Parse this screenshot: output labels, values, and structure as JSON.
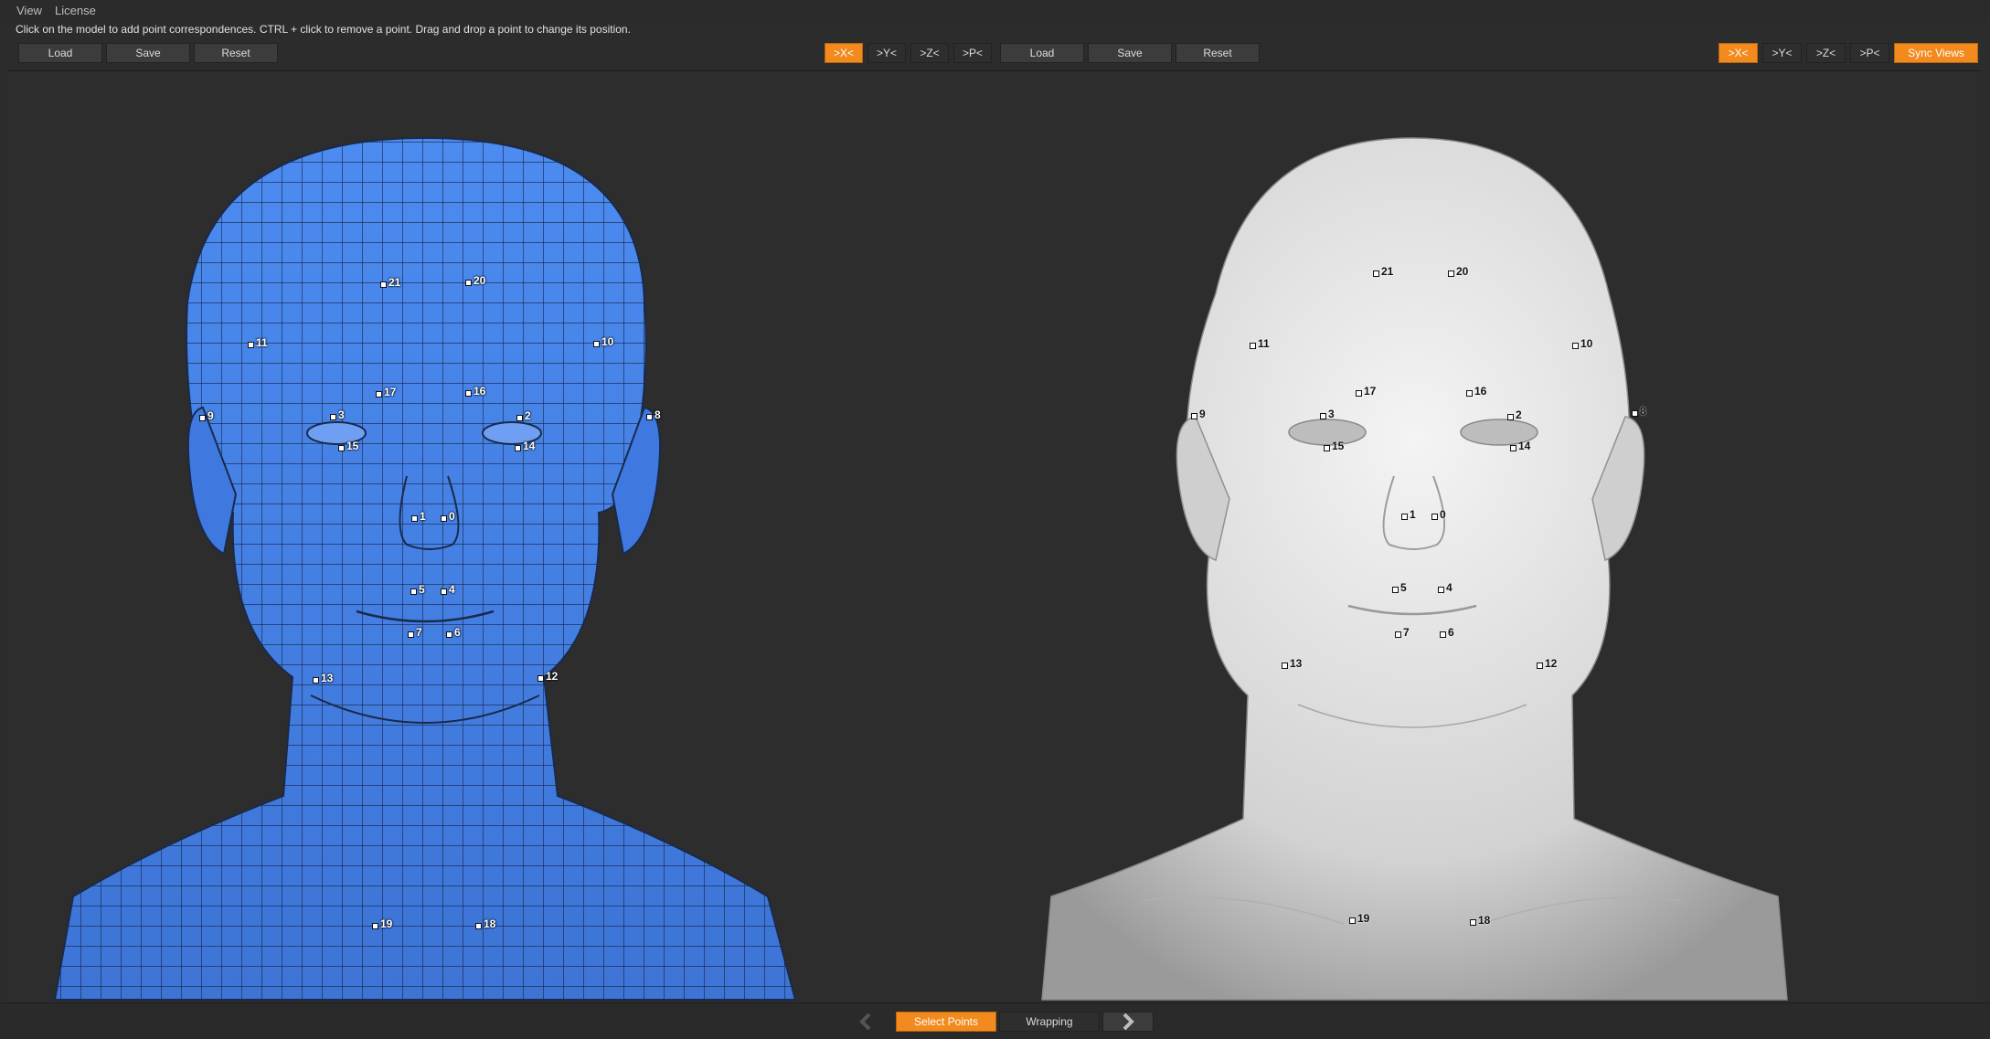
{
  "menu": {
    "view": "View",
    "license": "License"
  },
  "hint": "Click on the model to add point correspondences. CTRL + click to remove a point. Drag and drop a point to change its position.",
  "left_toolbar": {
    "load": "Load",
    "save": "Save",
    "reset": "Reset"
  },
  "right_toolbar": {
    "load": "Load",
    "save": "Save",
    "reset": "Reset"
  },
  "left_views": [
    ">X<",
    ">Y<",
    ">Z<",
    ">P<"
  ],
  "right_views": [
    ">X<",
    ">Y<",
    ">Z<",
    ">P<"
  ],
  "sync_views": "Sync Views",
  "bottom": {
    "select_points": "Select Points",
    "wrapping": "Wrapping"
  },
  "colors": {
    "accent": "#f28a1e",
    "mesh": "#4a86ea",
    "scan": "#d9d9d9"
  },
  "left_markers": [
    "21",
    "20",
    "11",
    "10",
    "17",
    "16",
    "9",
    "3",
    "2",
    "8",
    "15",
    "14",
    "1",
    "0",
    "5",
    "4",
    "7",
    "6",
    "13",
    "12",
    "19",
    "18"
  ],
  "right_markers": [
    "21",
    "20",
    "11",
    "10",
    "17",
    "16",
    "9",
    "3",
    "2",
    "8",
    "15",
    "14",
    "1",
    "0",
    "5",
    "4",
    "7",
    "6",
    "13",
    "12",
    "19",
    "18"
  ]
}
